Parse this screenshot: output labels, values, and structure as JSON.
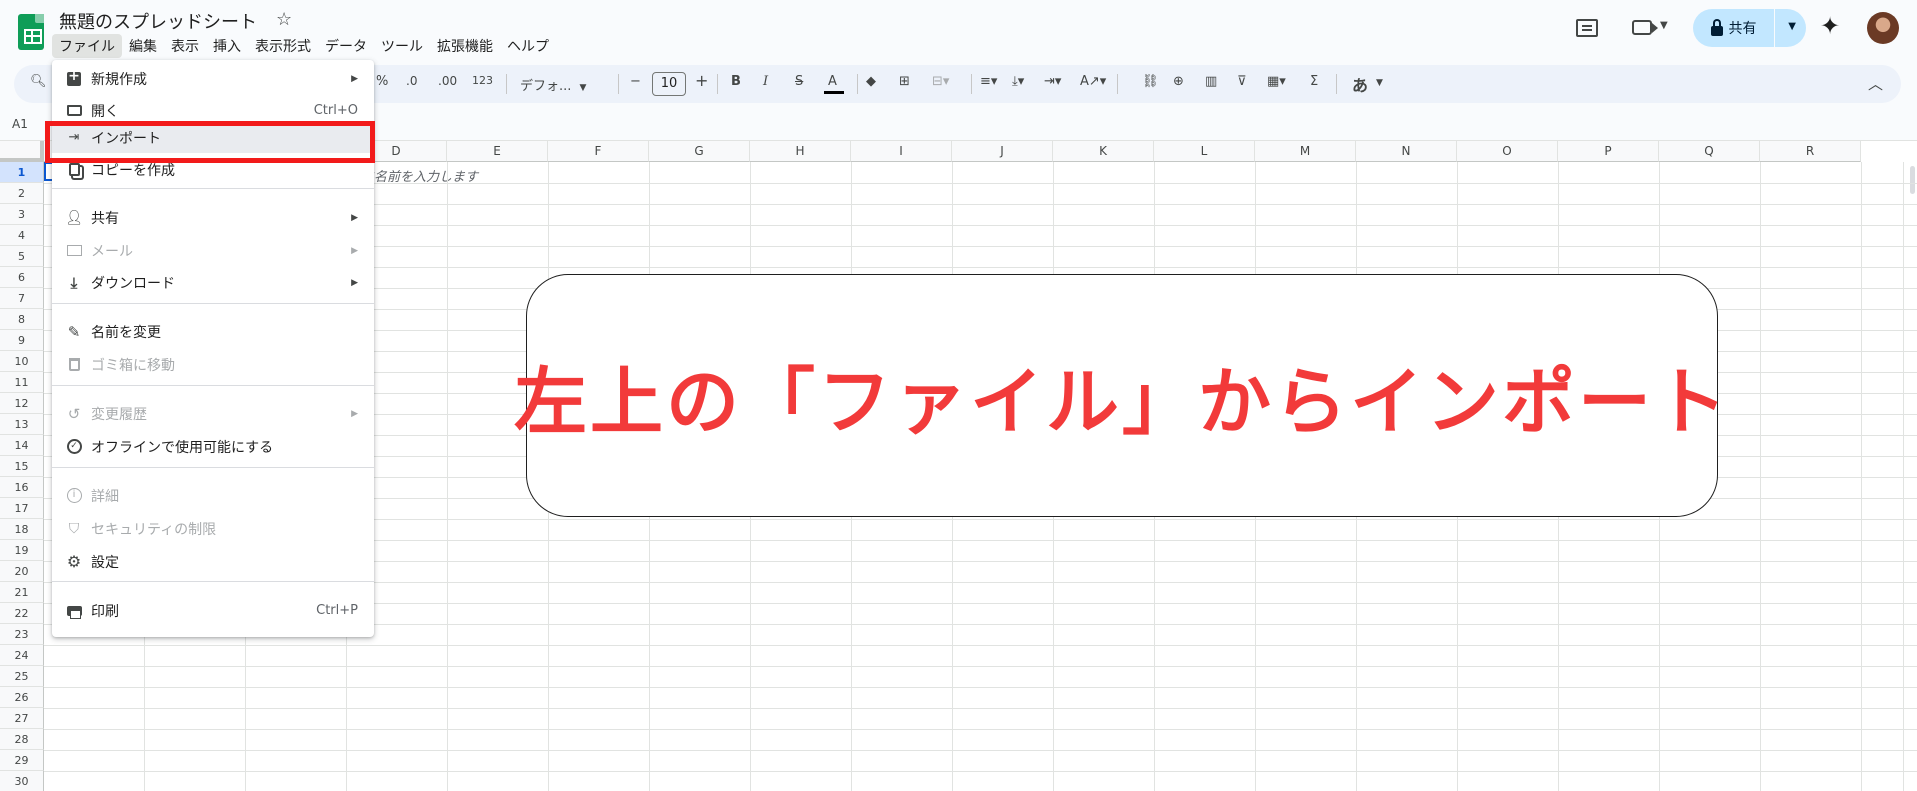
{
  "app": {
    "doc_title": "無題のスプレッドシート",
    "menubar": [
      "ファイル",
      "編集",
      "表示",
      "挿入",
      "表示形式",
      "データ",
      "ツール",
      "拡張機能",
      "ヘルプ"
    ],
    "share_label": "共有"
  },
  "toolbar": {
    "percent": "%",
    "decrease_decimal": ".0",
    "increase_decimal": ".00",
    "number_format": "123",
    "font_name": "デフォ...",
    "font_size": "10",
    "minus": "−",
    "plus": "+",
    "bold": "B",
    "italic": "I",
    "strikethrough": "S",
    "text_color": "A",
    "input_tools": "あ",
    "sum": "Σ"
  },
  "formula": {
    "name_box": "A1"
  },
  "grid": {
    "columns": [
      "D",
      "E",
      "F",
      "G",
      "H",
      "I",
      "J",
      "K",
      "L",
      "M",
      "N",
      "O",
      "P",
      "Q",
      "R"
    ],
    "rows": [
      "1",
      "2",
      "3",
      "4",
      "5",
      "6",
      "7",
      "8",
      "9",
      "10",
      "11",
      "12",
      "13",
      "14",
      "15",
      "16",
      "17",
      "18",
      "19",
      "20",
      "21",
      "22",
      "23",
      "24",
      "25",
      "26",
      "27",
      "28",
      "29",
      "30"
    ],
    "selected_row": "1",
    "placeholder": "に名前を入力します"
  },
  "menu": {
    "items": [
      {
        "label": "新規作成",
        "icon": "new-sheet-icon",
        "arrow": true,
        "shortcut": "",
        "disabled": false
      },
      {
        "label": "開く",
        "icon": "folder-icon",
        "arrow": false,
        "shortcut": "Ctrl+O",
        "disabled": false
      },
      {
        "label": "インポート",
        "icon": "import-icon",
        "arrow": false,
        "shortcut": "",
        "disabled": false
      },
      {
        "label": "コピーを作成",
        "icon": "copy-icon",
        "arrow": false,
        "shortcut": "",
        "disabled": false
      },
      {
        "label": "共有",
        "icon": "share-person-icon",
        "arrow": true,
        "shortcut": "",
        "disabled": false
      },
      {
        "label": "メール",
        "icon": "mail-icon",
        "arrow": true,
        "shortcut": "",
        "disabled": true
      },
      {
        "label": "ダウンロード",
        "icon": "download-icon",
        "arrow": true,
        "shortcut": "",
        "disabled": false
      },
      {
        "label": "名前を変更",
        "icon": "pencil-icon",
        "arrow": false,
        "shortcut": "",
        "disabled": false
      },
      {
        "label": "ゴミ箱に移動",
        "icon": "trash-icon",
        "arrow": false,
        "shortcut": "",
        "disabled": true
      },
      {
        "label": "変更履歴",
        "icon": "history-icon",
        "arrow": true,
        "shortcut": "",
        "disabled": true
      },
      {
        "label": "オフラインで使用可能にする",
        "icon": "offline-icon",
        "arrow": false,
        "shortcut": "",
        "disabled": false
      },
      {
        "label": "詳細",
        "icon": "info-icon",
        "arrow": false,
        "shortcut": "",
        "disabled": true
      },
      {
        "label": "セキュリティの制限",
        "icon": "security-icon",
        "arrow": false,
        "shortcut": "",
        "disabled": true
      },
      {
        "label": "設定",
        "icon": "gear-icon",
        "arrow": false,
        "shortcut": "",
        "disabled": false
      },
      {
        "label": "印刷",
        "icon": "print-icon",
        "arrow": false,
        "shortcut": "Ctrl+P",
        "disabled": false
      }
    ]
  },
  "banner": {
    "text": "左上の「ファイル」からインポート"
  },
  "colors": {
    "highlight_box": "#f21a1a",
    "banner_text": "#f23a3a",
    "share_button": "#c2e7ff",
    "sheets_green": "#0f9d58"
  }
}
